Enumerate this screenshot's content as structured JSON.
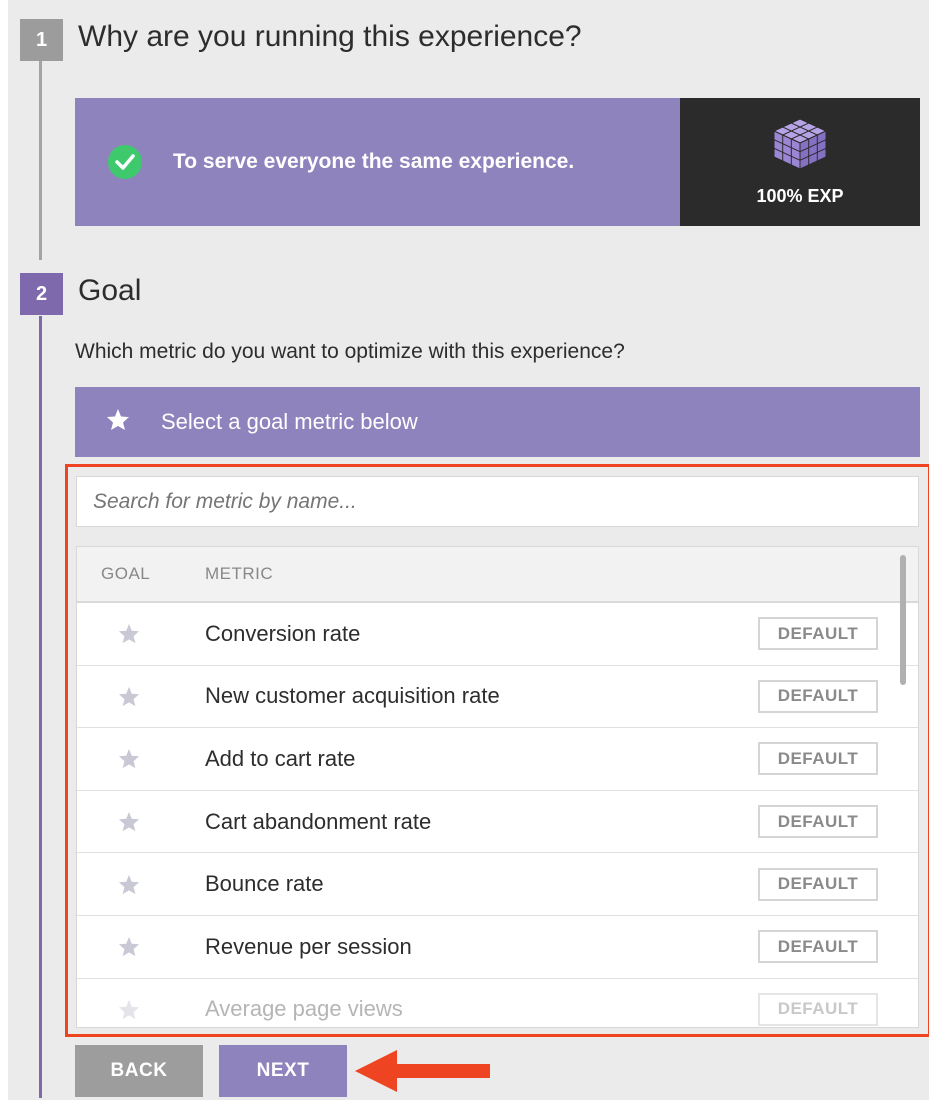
{
  "step1": {
    "number": "1",
    "title": "Why are you running this experience?",
    "selection_text": "To serve everyone the same experience.",
    "side_label": "100% EXP",
    "icon": "cube-icon"
  },
  "step2": {
    "number": "2",
    "title": "Goal",
    "question": "Which metric do you want to optimize with this experience?",
    "banner_text": "Select a goal metric below",
    "search_placeholder": "Search for metric by name...",
    "columns": {
      "goal": "GOAL",
      "metric": "METRIC"
    },
    "rows": [
      {
        "metric": "Conversion rate",
        "badge": "DEFAULT"
      },
      {
        "metric": "New customer acquisition rate",
        "badge": "DEFAULT"
      },
      {
        "metric": "Add to cart rate",
        "badge": "DEFAULT"
      },
      {
        "metric": "Cart abandonment rate",
        "badge": "DEFAULT"
      },
      {
        "metric": "Bounce rate",
        "badge": "DEFAULT"
      },
      {
        "metric": "Revenue per session",
        "badge": "DEFAULT"
      },
      {
        "metric": "Average page views",
        "badge": "DEFAULT"
      }
    ]
  },
  "buttons": {
    "back": "BACK",
    "next": "NEXT"
  },
  "colors": {
    "accent": "#8e83bd",
    "step_purple": "#7d69ac",
    "highlight": "#ee4422",
    "check": "#3ec96d",
    "dark_card": "#2b2b2b"
  }
}
